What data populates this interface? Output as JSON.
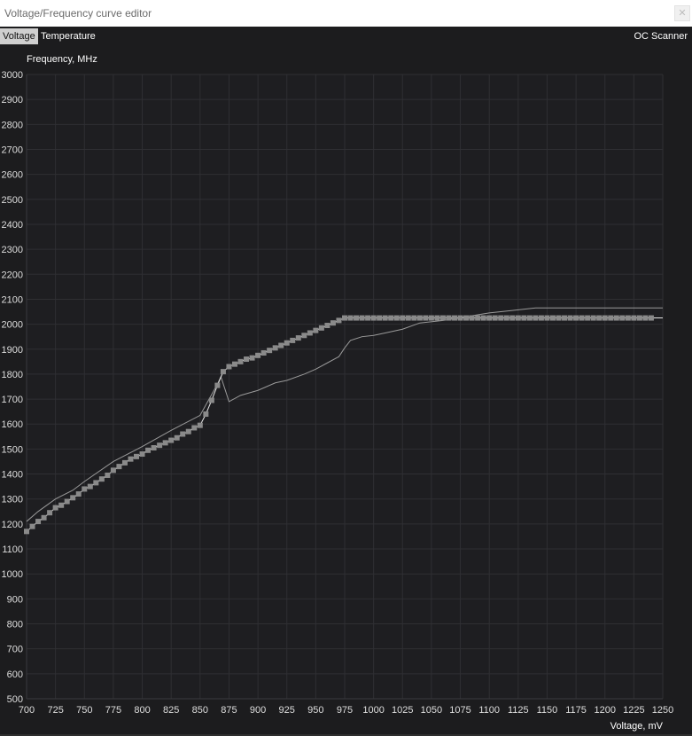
{
  "window": {
    "title": "Voltage/Frequency curve editor",
    "close_icon": "close-icon"
  },
  "tabs": [
    {
      "label": "Voltage",
      "active": true
    },
    {
      "label": "Temperature",
      "active": false
    }
  ],
  "scanner_label": "OC Scanner",
  "colors": {
    "background": "#1c1c1e",
    "grid": "#2f2f33",
    "curve_points": "#8a8a8a",
    "curve_line": "#e6e6e6",
    "reference_line": "#9a9a9a"
  },
  "chart_data": {
    "type": "line",
    "xlabel": "Voltage, mV",
    "ylabel": "Frequency, MHz",
    "xlim": [
      700,
      1250
    ],
    "ylim": [
      500,
      3000
    ],
    "grid": true,
    "x_ticks": [
      700,
      725,
      750,
      775,
      800,
      825,
      850,
      875,
      900,
      925,
      950,
      975,
      1000,
      1025,
      1050,
      1075,
      1100,
      1125,
      1150,
      1175,
      1200,
      1225,
      1250
    ],
    "y_ticks": [
      500,
      600,
      700,
      800,
      900,
      1000,
      1100,
      1200,
      1300,
      1400,
      1500,
      1600,
      1700,
      1800,
      1900,
      2000,
      2100,
      2200,
      2300,
      2400,
      2500,
      2600,
      2700,
      2800,
      2900,
      3000
    ],
    "series": [
      {
        "role": "edited-curve",
        "points": [
          [
            700,
            1170
          ],
          [
            705,
            1190
          ],
          [
            710,
            1210
          ],
          [
            715,
            1225
          ],
          [
            720,
            1245
          ],
          [
            725,
            1265
          ],
          [
            730,
            1275
          ],
          [
            735,
            1290
          ],
          [
            740,
            1305
          ],
          [
            745,
            1320
          ],
          [
            750,
            1340
          ],
          [
            755,
            1350
          ],
          [
            760,
            1365
          ],
          [
            765,
            1380
          ],
          [
            770,
            1395
          ],
          [
            775,
            1415
          ],
          [
            780,
            1430
          ],
          [
            785,
            1445
          ],
          [
            790,
            1460
          ],
          [
            795,
            1470
          ],
          [
            800,
            1480
          ],
          [
            805,
            1495
          ],
          [
            810,
            1505
          ],
          [
            815,
            1515
          ],
          [
            820,
            1525
          ],
          [
            825,
            1535
          ],
          [
            830,
            1545
          ],
          [
            835,
            1560
          ],
          [
            840,
            1570
          ],
          [
            845,
            1585
          ],
          [
            850,
            1595
          ],
          [
            855,
            1640
          ],
          [
            860,
            1695
          ],
          [
            865,
            1755
          ],
          [
            870,
            1810
          ],
          [
            875,
            1830
          ],
          [
            880,
            1840
          ],
          [
            885,
            1850
          ],
          [
            890,
            1860
          ],
          [
            895,
            1865
          ],
          [
            900,
            1875
          ],
          [
            905,
            1885
          ],
          [
            910,
            1895
          ],
          [
            915,
            1905
          ],
          [
            920,
            1915
          ],
          [
            925,
            1925
          ],
          [
            930,
            1935
          ],
          [
            935,
            1945
          ],
          [
            940,
            1955
          ],
          [
            945,
            1965
          ],
          [
            950,
            1975
          ],
          [
            955,
            1985
          ],
          [
            960,
            1995
          ],
          [
            965,
            2005
          ],
          [
            970,
            2015
          ],
          [
            975,
            2025
          ],
          [
            980,
            2025
          ],
          [
            985,
            2025
          ],
          [
            990,
            2025
          ],
          [
            995,
            2025
          ],
          [
            1000,
            2025
          ],
          [
            1005,
            2025
          ],
          [
            1010,
            2025
          ],
          [
            1015,
            2025
          ],
          [
            1020,
            2025
          ],
          [
            1025,
            2025
          ],
          [
            1030,
            2025
          ],
          [
            1035,
            2025
          ],
          [
            1040,
            2025
          ],
          [
            1045,
            2025
          ],
          [
            1050,
            2025
          ],
          [
            1055,
            2025
          ],
          [
            1060,
            2025
          ],
          [
            1065,
            2025
          ],
          [
            1070,
            2025
          ],
          [
            1075,
            2025
          ],
          [
            1080,
            2025
          ],
          [
            1085,
            2025
          ],
          [
            1090,
            2025
          ],
          [
            1095,
            2025
          ],
          [
            1100,
            2025
          ],
          [
            1105,
            2025
          ],
          [
            1110,
            2025
          ],
          [
            1115,
            2025
          ],
          [
            1120,
            2025
          ],
          [
            1125,
            2025
          ],
          [
            1130,
            2025
          ],
          [
            1135,
            2025
          ],
          [
            1140,
            2025
          ],
          [
            1145,
            2025
          ],
          [
            1150,
            2025
          ],
          [
            1155,
            2025
          ],
          [
            1160,
            2025
          ],
          [
            1165,
            2025
          ],
          [
            1170,
            2025
          ],
          [
            1175,
            2025
          ],
          [
            1180,
            2025
          ],
          [
            1185,
            2025
          ],
          [
            1190,
            2025
          ],
          [
            1195,
            2025
          ],
          [
            1200,
            2025
          ],
          [
            1205,
            2025
          ],
          [
            1210,
            2025
          ],
          [
            1215,
            2025
          ],
          [
            1220,
            2025
          ],
          [
            1225,
            2025
          ],
          [
            1230,
            2025
          ],
          [
            1235,
            2025
          ],
          [
            1240,
            2025
          ]
        ]
      },
      {
        "role": "upper-reference",
        "points": [
          [
            700,
            1210
          ],
          [
            710,
            1250
          ],
          [
            725,
            1300
          ],
          [
            740,
            1335
          ],
          [
            750,
            1370
          ],
          [
            775,
            1450
          ],
          [
            800,
            1510
          ],
          [
            825,
            1575
          ],
          [
            850,
            1635
          ],
          [
            865,
            1760
          ],
          [
            868,
            1790
          ],
          [
            875,
            1690
          ],
          [
            885,
            1715
          ],
          [
            900,
            1735
          ],
          [
            915,
            1765
          ],
          [
            925,
            1775
          ],
          [
            940,
            1800
          ],
          [
            950,
            1820
          ],
          [
            960,
            1845
          ],
          [
            970,
            1870
          ],
          [
            975,
            1905
          ],
          [
            980,
            1935
          ],
          [
            990,
            1950
          ],
          [
            1000,
            1955
          ],
          [
            1010,
            1965
          ],
          [
            1025,
            1980
          ],
          [
            1040,
            2005
          ],
          [
            1060,
            2015
          ],
          [
            1080,
            2030
          ],
          [
            1100,
            2045
          ],
          [
            1120,
            2055
          ],
          [
            1140,
            2065
          ],
          [
            1175,
            2065
          ],
          [
            1200,
            2065
          ],
          [
            1250,
            2065
          ]
        ]
      }
    ]
  }
}
